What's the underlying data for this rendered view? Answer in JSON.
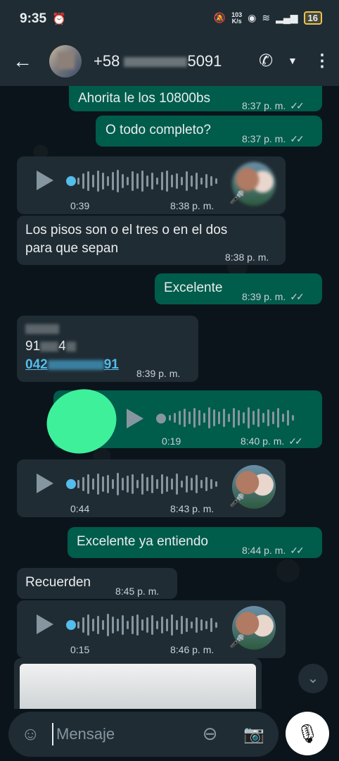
{
  "status": {
    "time": "9:35",
    "speed_top": "103",
    "speed_bottom": "K/s",
    "battery": "16"
  },
  "header": {
    "contact_prefix": "+58",
    "contact_suffix": "5091"
  },
  "messages": {
    "m1_text": "Ahorita le los 10800bs",
    "m1_time": "8:37 p. m.",
    "m2_text": "O todo completo?",
    "m2_time": "8:37 p. m.",
    "v1_duration": "0:39",
    "v1_time": "8:38 p. m.",
    "m3_line1": "Los pisos son o el tres o en el dos",
    "m3_line2": "para que sepan",
    "m3_time": "8:38 p. m.",
    "m4_text": "Excelente",
    "m4_time": "8:39 p. m.",
    "m5_line2": "91",
    "m5_line2b": "4",
    "m5_link_a": "042",
    "m5_link_b": "91",
    "m5_time": "8:39 p. m.",
    "v2_duration": "0:19",
    "v2_time": "8:40 p. m.",
    "v3_duration": "0:44",
    "v3_time": "8:43 p. m.",
    "m6_text": "Excelente ya entiendo",
    "m6_time": "8:44 p. m.",
    "m7_text": "Recuerden",
    "m7_time": "8:45 p. m.",
    "v4_duration": "0:15",
    "v4_time": "8:46 p. m."
  },
  "input": {
    "placeholder": "Mensaje"
  }
}
